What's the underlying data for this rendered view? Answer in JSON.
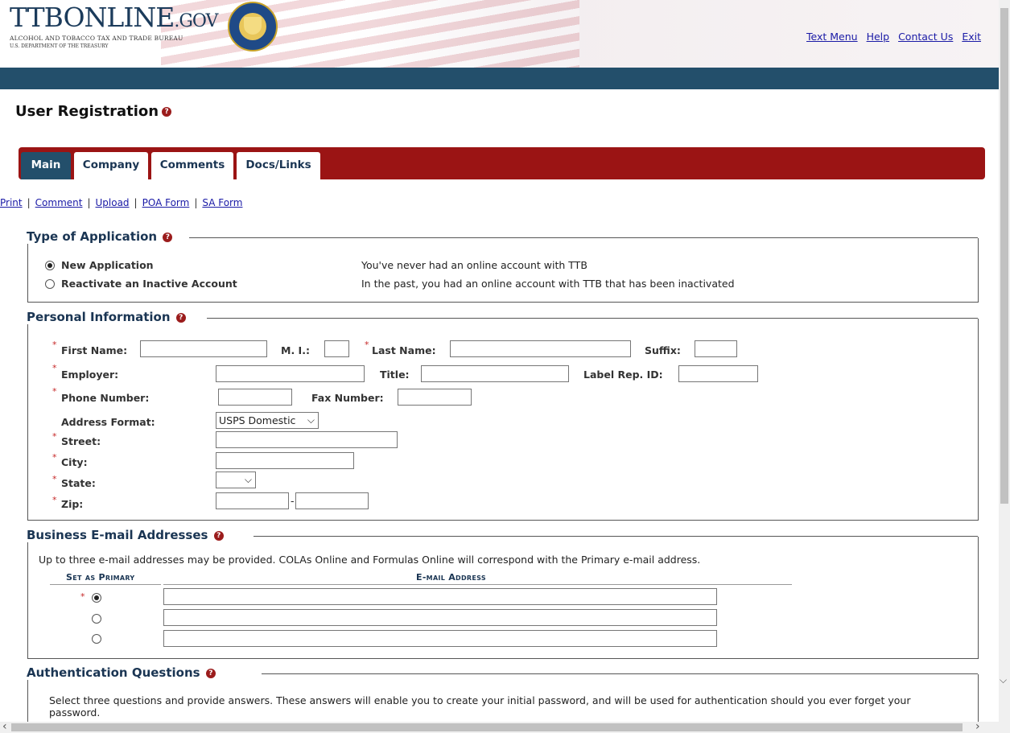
{
  "header": {
    "logo_main": "TTBONLINE",
    "logo_gov": ".GOV",
    "logo_sub1": "ALCOHOL AND TOBACCO TAX AND TRADE BUREAU",
    "logo_sub2": "U.S. DEPARTMENT OF THE TREASURY",
    "links": [
      "Text Menu",
      "Help",
      "Contact Us",
      "Exit"
    ]
  },
  "page_title": "User Registration",
  "tabs": [
    "Main",
    "Company",
    "Comments",
    "Docs/Links"
  ],
  "active_tab": "Main",
  "sublinks": [
    "Print",
    "Comment",
    "Upload",
    "POA Form",
    "SA Form"
  ],
  "type_of_application": {
    "legend": "Type of Application",
    "options": [
      {
        "label": "New Application",
        "description": "You've never had an online account with TTB",
        "selected": true
      },
      {
        "label": "Reactivate an Inactive Account",
        "description": "In the past, you had an online account with TTB that has been inactivated",
        "selected": false
      }
    ]
  },
  "personal_information": {
    "legend": "Personal Information",
    "first_name": "First Name:",
    "mi": "M. I.:",
    "last_name": "Last Name:",
    "suffix": "Suffix:",
    "employer": "Employer:",
    "title": "Title:",
    "label_rep_id": "Label Rep. ID:",
    "phone": "Phone Number:",
    "fax": "Fax Number:",
    "address_format": "Address Format:",
    "address_format_value": "USPS Domestic",
    "street": "Street:",
    "city": "City:",
    "state": "State:",
    "zip": "Zip:",
    "zip_sep": "-"
  },
  "email": {
    "legend": "Business E-mail Addresses",
    "note": "Up to three e-mail addresses may be provided. COLAs Online and Formulas Online will correspond with the Primary e-mail address.",
    "col_primary": "Set as Primary",
    "col_address": "E-mail Address",
    "primary_index": 0
  },
  "authentication": {
    "legend": "Authentication Questions",
    "note_line1": "Select three questions and provide answers. These answers will enable you to create your initial password, and will be used for authentication should you ever forget your",
    "note_line2": "password."
  },
  "colors": {
    "tab_bar": "#9b1414",
    "nav_bar": "#234f6b",
    "link": "#1a1aa6",
    "required": "#c62828"
  },
  "icons": {
    "help": "question-circle-icon",
    "dropdown": "chevron-down-icon"
  },
  "glyphs": {
    "help": "?",
    "required": "*",
    "chevron_down": "⌵",
    "arrow_up": "⌃",
    "arrow_left": "‹",
    "arrow_right": "›"
  }
}
